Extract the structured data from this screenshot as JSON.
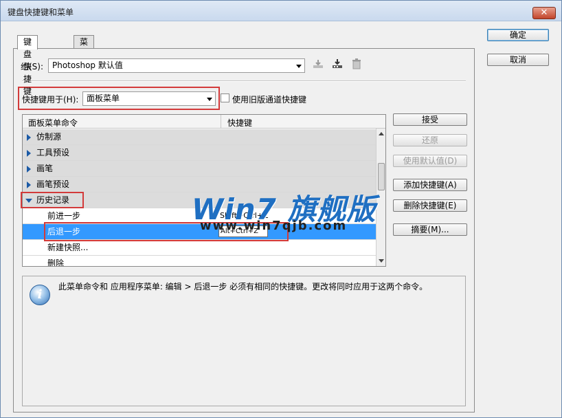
{
  "window": {
    "title": "键盘快捷键和菜单",
    "close_label": "✕"
  },
  "tabs": [
    {
      "label": "键盘快捷键"
    },
    {
      "label": "菜单"
    }
  ],
  "set": {
    "label": "组(S):",
    "value": "Photoshop 默认值",
    "icons": [
      "save-set-icon",
      "save-as-set-icon",
      "delete-set-icon"
    ]
  },
  "shortcuts_for": {
    "label": "快捷键用于(H):",
    "value": "面板菜单"
  },
  "legacy_checkbox": {
    "label": "使用旧版通道快捷键",
    "checked": false
  },
  "table": {
    "columns": [
      "面板菜单命令",
      "快捷键"
    ],
    "rows": [
      {
        "name": "仿制源",
        "type": "group",
        "expanded": false
      },
      {
        "name": "工具预设",
        "type": "group",
        "expanded": false
      },
      {
        "name": "画笔",
        "type": "group",
        "expanded": false
      },
      {
        "name": "画笔预设",
        "type": "group",
        "expanded": false
      },
      {
        "name": "历史记录",
        "type": "group",
        "expanded": true
      },
      {
        "name": "前进一步",
        "type": "item",
        "shortcut": "Shift+Ctrl+Z"
      },
      {
        "name": "后退一步",
        "type": "item",
        "shortcut": "Alt+Ctrl+Z",
        "selected": true
      },
      {
        "name": "新建快照...",
        "type": "item",
        "shortcut": ""
      },
      {
        "name": "删除",
        "type": "item",
        "shortcut": ""
      }
    ]
  },
  "side_buttons": [
    {
      "label": "接受",
      "enabled": true
    },
    {
      "label": "还原",
      "enabled": false
    },
    {
      "label": "使用默认值(D)",
      "enabled": false
    },
    {
      "label": "添加快捷键(A)",
      "enabled": true
    },
    {
      "label": "删除快捷键(E)",
      "enabled": true
    },
    {
      "label": "摘要(M)...",
      "enabled": true
    }
  ],
  "dialog_buttons": {
    "ok": "确定",
    "cancel": "取消"
  },
  "info_message": "此菜单命令和 应用程序菜单: 编辑 > 后退一步 必须有相同的快捷键。更改将同时应用于这两个命令。",
  "watermark": {
    "title": "Win7 旗舰版",
    "url": "www.win7qjb.com"
  },
  "colors": {
    "selection": "#3399ff",
    "highlight_box": "#d33a3a",
    "watermark": "#1f6fc2"
  }
}
